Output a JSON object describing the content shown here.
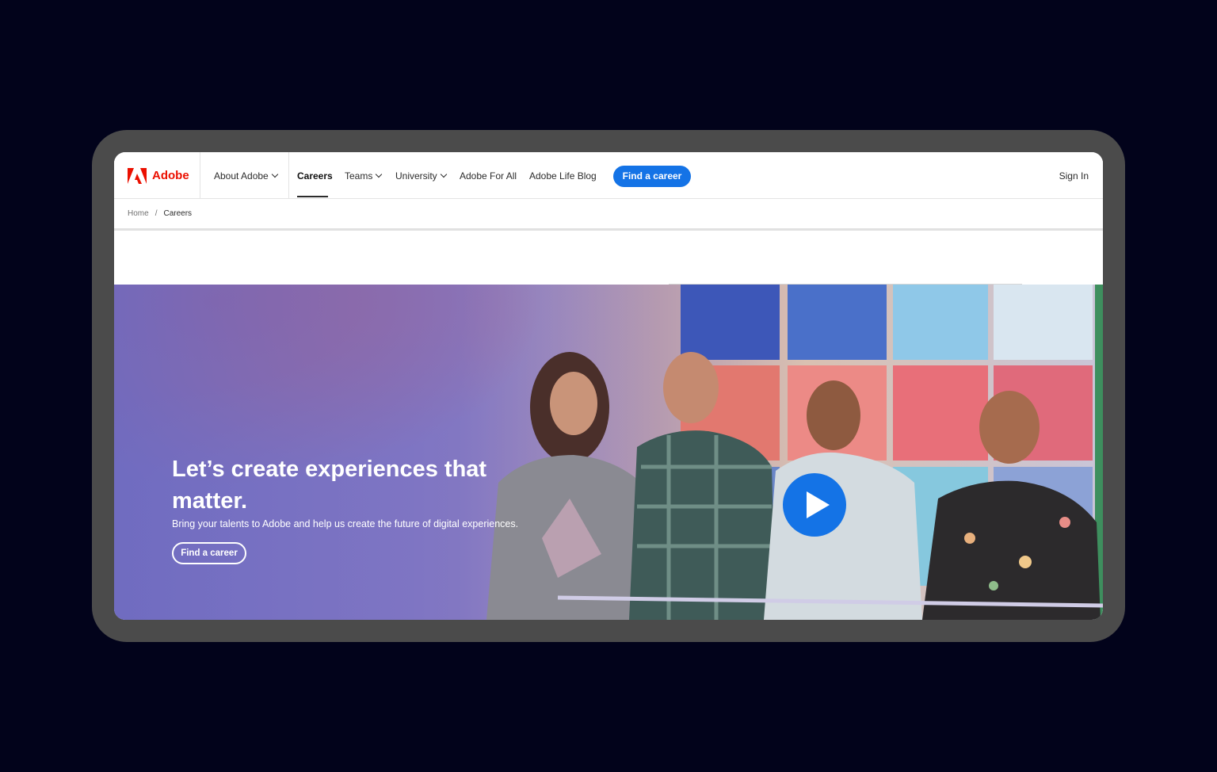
{
  "brand": {
    "name": "Adobe",
    "logo_color": "#eb1000"
  },
  "nav": {
    "about": "About Adobe",
    "careers": "Careers",
    "teams": "Teams",
    "university": "University",
    "for_all": "Adobe For All",
    "blog": "Adobe Life Blog",
    "cta": "Find a career",
    "sign_in": "Sign In"
  },
  "breadcrumb": {
    "home": "Home",
    "separator": "/",
    "current": "Careers"
  },
  "hero": {
    "title": "Let’s create experiences that matter.",
    "subtitle": "Bring your talents to Adobe and help us create the future of digital experiences.",
    "button": "Find a career",
    "play_icon": "play-icon"
  },
  "colors": {
    "accent": "#1473e6",
    "background": "#02031b",
    "frame": "#4b4b4b"
  }
}
